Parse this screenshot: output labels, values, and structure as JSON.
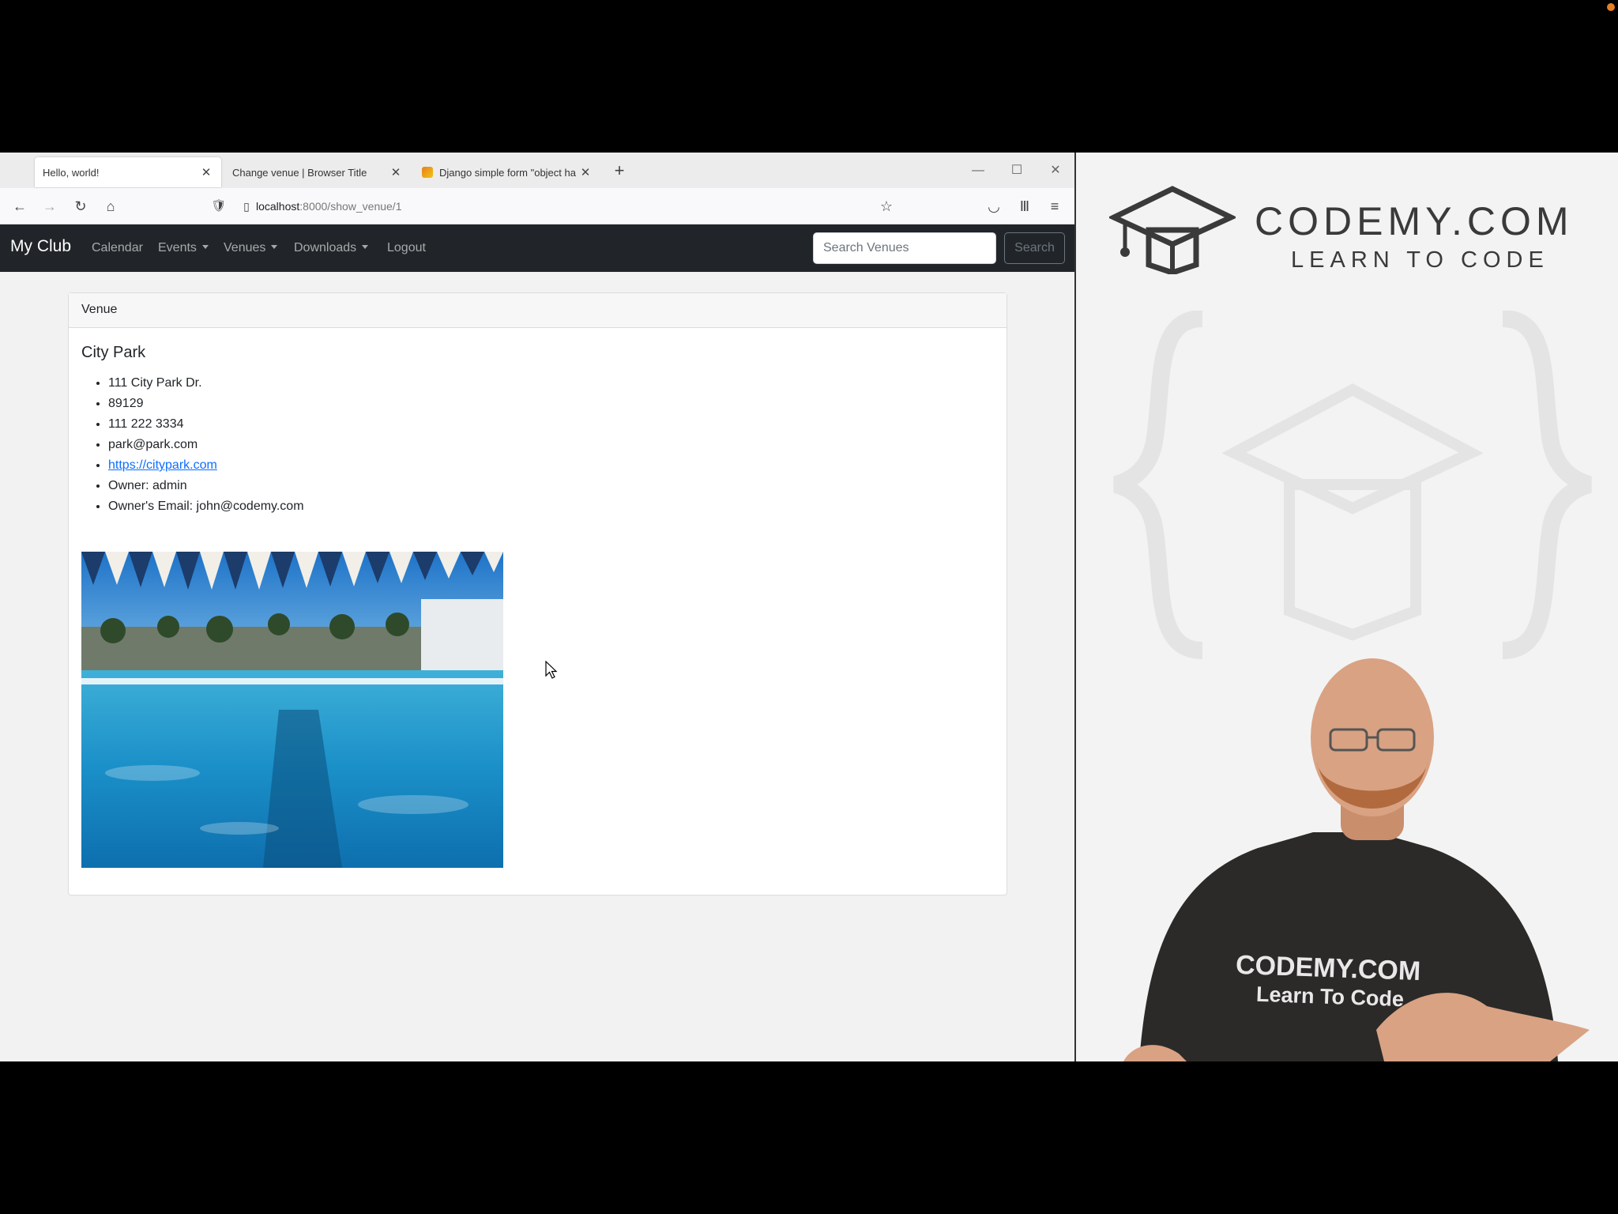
{
  "browser": {
    "tabs": [
      {
        "label": "Hello, world!",
        "active": true
      },
      {
        "label": "Change venue | Browser Title",
        "active": false
      },
      {
        "label": "Django simple form \"object ha",
        "active": false
      }
    ],
    "url": {
      "host": "localhost",
      "path": ":8000/show_venue/1"
    }
  },
  "site": {
    "brand": "My Club",
    "nav": {
      "calendar": "Calendar",
      "events": "Events",
      "venues": "Venues",
      "downloads": "Downloads",
      "logout": "Logout"
    },
    "search": {
      "placeholder": "Search Venues",
      "button": "Search"
    }
  },
  "card": {
    "header": "Venue",
    "title": "City Park",
    "info": {
      "address": "111 City Park Dr.",
      "zip": "89129",
      "phone": "111 222 3334",
      "email": "park@park.com",
      "website": "https://citypark.com",
      "owner": "Owner: admin",
      "owner_email": "Owner's Email: john@codemy.com"
    }
  },
  "overlay": {
    "logo_text": "CODEMY.COM",
    "logo_sub": "LEARN TO CODE",
    "shirt_line1": "CODEMY.COM",
    "shirt_line2": "Learn To Code"
  },
  "colors": {
    "navbar": "#212529",
    "link": "#0d6efd",
    "brand_gray": "#3a3a3a"
  }
}
